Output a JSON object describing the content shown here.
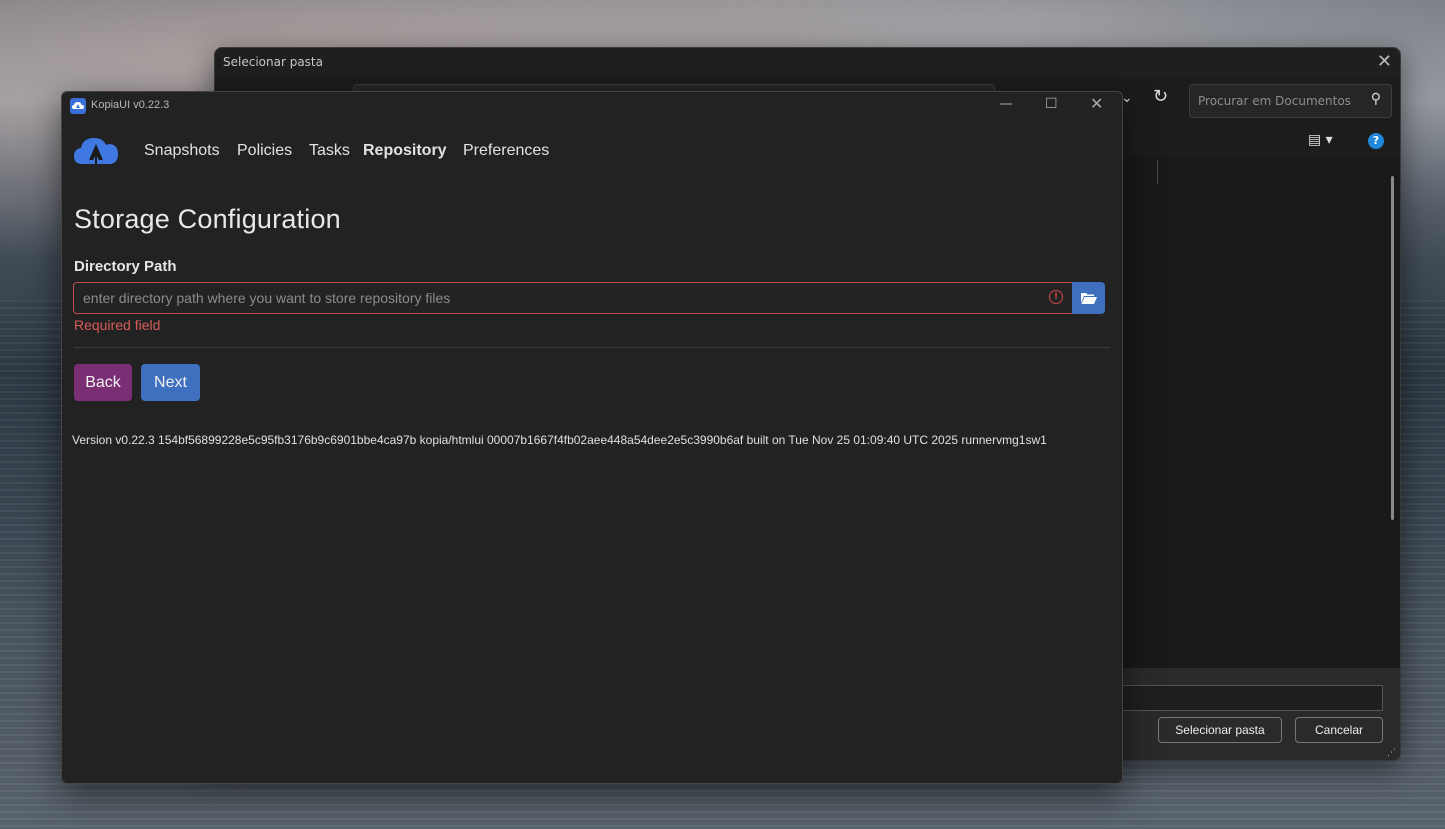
{
  "file_dialog": {
    "title": "Selecionar pasta",
    "search_placeholder": "Procurar em Documentos",
    "select_button": "Selecionar pasta",
    "cancel_button": "Cancelar",
    "help_symbol": "?"
  },
  "window": {
    "title": "KopiaUI v0.22.3"
  },
  "nav": {
    "items": [
      {
        "label": "Snapshots",
        "active": false
      },
      {
        "label": "Policies",
        "active": false
      },
      {
        "label": "Tasks",
        "active": false
      },
      {
        "label": "Repository",
        "active": true
      },
      {
        "label": "Preferences",
        "active": false
      }
    ]
  },
  "page": {
    "heading": "Storage Configuration",
    "directory_label": "Directory Path",
    "directory_placeholder": "enter directory path where you want to store repository files",
    "directory_value": "",
    "error_text": "Required field",
    "back_label": "Back",
    "next_label": "Next",
    "version_text": "Version v0.22.3 154bf56899228e5c95fb3176b9c6901bbe4ca97b kopia/htmlui 00007b1667f4fb02aee448a54dee2e5c3990b6af built on Tue Nov 25 01:09:40 UTC 2025 runnervmg1sw1"
  },
  "colors": {
    "accent_blue": "#3f6fbf",
    "back_purple": "#7a2f75",
    "error_red": "#d65a5a",
    "window_bg": "#222222"
  },
  "icons": {
    "app": "kopia-cloud-icon",
    "browse": "folder-open-icon",
    "warning": "exclamation-circle-icon",
    "search": "search-icon",
    "refresh": "refresh-icon"
  }
}
